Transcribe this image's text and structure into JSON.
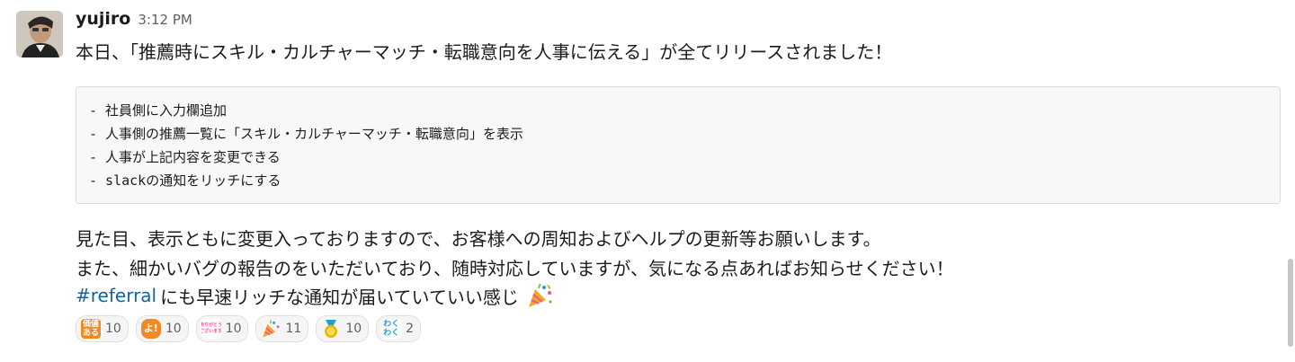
{
  "message": {
    "username": "yujiro",
    "timestamp": "3:12 PM",
    "line1": "本日、「推薦時にスキル・カルチャーマッチ・転職意向を人事に伝える」が全てリリースされました！",
    "code_lines": [
      "- 社員側に入力欄追加",
      "- 人事側の推薦一覧に「スキル・カルチャーマッチ・転職意向」を表示",
      "- 人事が上記内容を変更できる",
      "- slackの通知をリッチにする"
    ],
    "para1": "見た目、表示ともに変更入っておりますので、お客様への周知およびヘルプの更新等お願いします。",
    "para2": "また、細かいバグの報告のをいただいており、随時対応していますが、気になる点あればお知らせください！",
    "channel": "#referral",
    "para3": "にも早速リッチな通知が届いていていい感じ"
  },
  "reactions": [
    {
      "icon": "kachi-aru-emoji",
      "label": "価値\nある",
      "count": "10",
      "color": "#f08a24"
    },
    {
      "icon": "yo-emoji",
      "label": "よ!",
      "count": "10",
      "color": "#f08a24"
    },
    {
      "icon": "arigatou-emoji",
      "label": "ありがとう\nございます",
      "count": "10",
      "color": "#e8559a"
    },
    {
      "icon": "tada-emoji",
      "label": "",
      "count": "11",
      "color": "#f5b400"
    },
    {
      "icon": "medal-emoji",
      "label": "",
      "count": "10",
      "color": "#f0b400"
    },
    {
      "icon": "wakuwaku-emoji",
      "label": "わく\nわく",
      "count": "2",
      "color": "#2a9bd6"
    }
  ]
}
